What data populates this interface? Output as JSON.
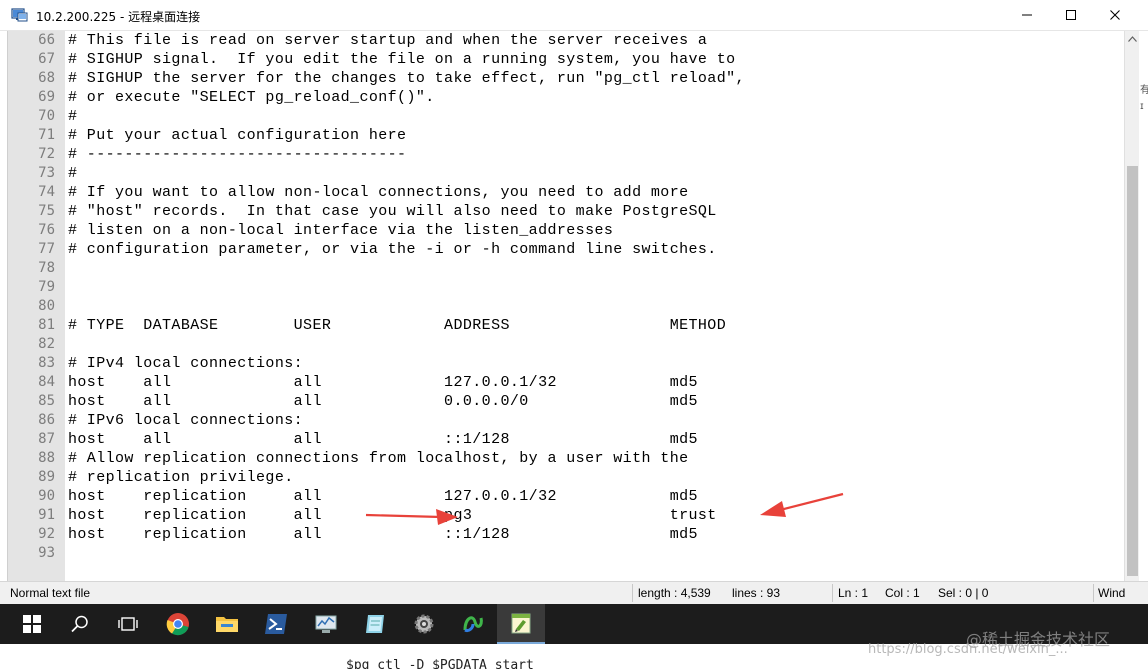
{
  "window": {
    "title": "10.2.200.225 - 远程桌面连接",
    "minimize_glyph": "—",
    "maximize_glyph": "☐",
    "close_glyph": "✕"
  },
  "editor": {
    "gutter": [
      "66",
      "67",
      "68",
      "69",
      "70",
      "71",
      "72",
      "73",
      "74",
      "75",
      "76",
      "77",
      "78",
      "79",
      "80",
      "81",
      "82",
      "83",
      "84",
      "85",
      "86",
      "87",
      "88",
      "89",
      "90",
      "91",
      "92",
      "93"
    ],
    "lines": [
      "# This file is read on server startup and when the server receives a",
      "# SIGHUP signal.  If you edit the file on a running system, you have to",
      "# SIGHUP the server for the changes to take effect, run \"pg_ctl reload\",",
      "# or execute \"SELECT pg_reload_conf()\".",
      "#",
      "# Put your actual configuration here",
      "# ----------------------------------",
      "#",
      "# If you want to allow non-local connections, you need to add more",
      "# \"host\" records.  In that case you will also need to make PostgreSQL",
      "# listen on a non-local interface via the listen_addresses",
      "# configuration parameter, or via the -i or -h command line switches.",
      "",
      "",
      "",
      "# TYPE  DATABASE        USER            ADDRESS                 METHOD",
      "",
      "# IPv4 local connections:",
      "host    all             all             127.0.0.1/32            md5",
      "host    all             all             0.0.0.0/0               md5",
      "# IPv6 local connections:",
      "host    all             all             ::1/128                 md5",
      "# Allow replication connections from localhost, by a user with the",
      "# replication privilege.",
      "host    replication     all             127.0.0.1/32            md5",
      "host    replication     all             pg3                     trust",
      "host    replication     all             ::1/128                 md5",
      ""
    ],
    "annotation_color": "#e8423a"
  },
  "statusbar": {
    "file_type": "Normal text file",
    "length": "length : 4,539",
    "lines": "lines : 93",
    "ln": "Ln : 1",
    "col": "Col : 1",
    "sel": "Sel : 0 | 0",
    "eol": "Wind"
  },
  "taskbar": {
    "icons": [
      "windows-start-icon",
      "search-icon",
      "task-view-icon",
      "chrome-icon",
      "file-explorer-icon",
      "powershell-icon",
      "network-monitor-icon",
      "notepad-app-icon",
      "settings-gear-icon",
      "navicat-icon",
      "notepad-plus-plus-icon"
    ]
  },
  "background": {
    "partial_text": "$pg_ctl -D $PGDATA   start",
    "right_edge_glyphs": [
      "有",
      "ɪ"
    ]
  },
  "watermarks": {
    "brand": "@稀土掘金技术社区",
    "url": "https://blog.csdn.net/weixin_..."
  },
  "colors": {
    "gutter": "#e4e4e4",
    "taskbar": "#1c1c1c",
    "statusbar": "#f0f0f0",
    "arrow": "#e8423a"
  }
}
